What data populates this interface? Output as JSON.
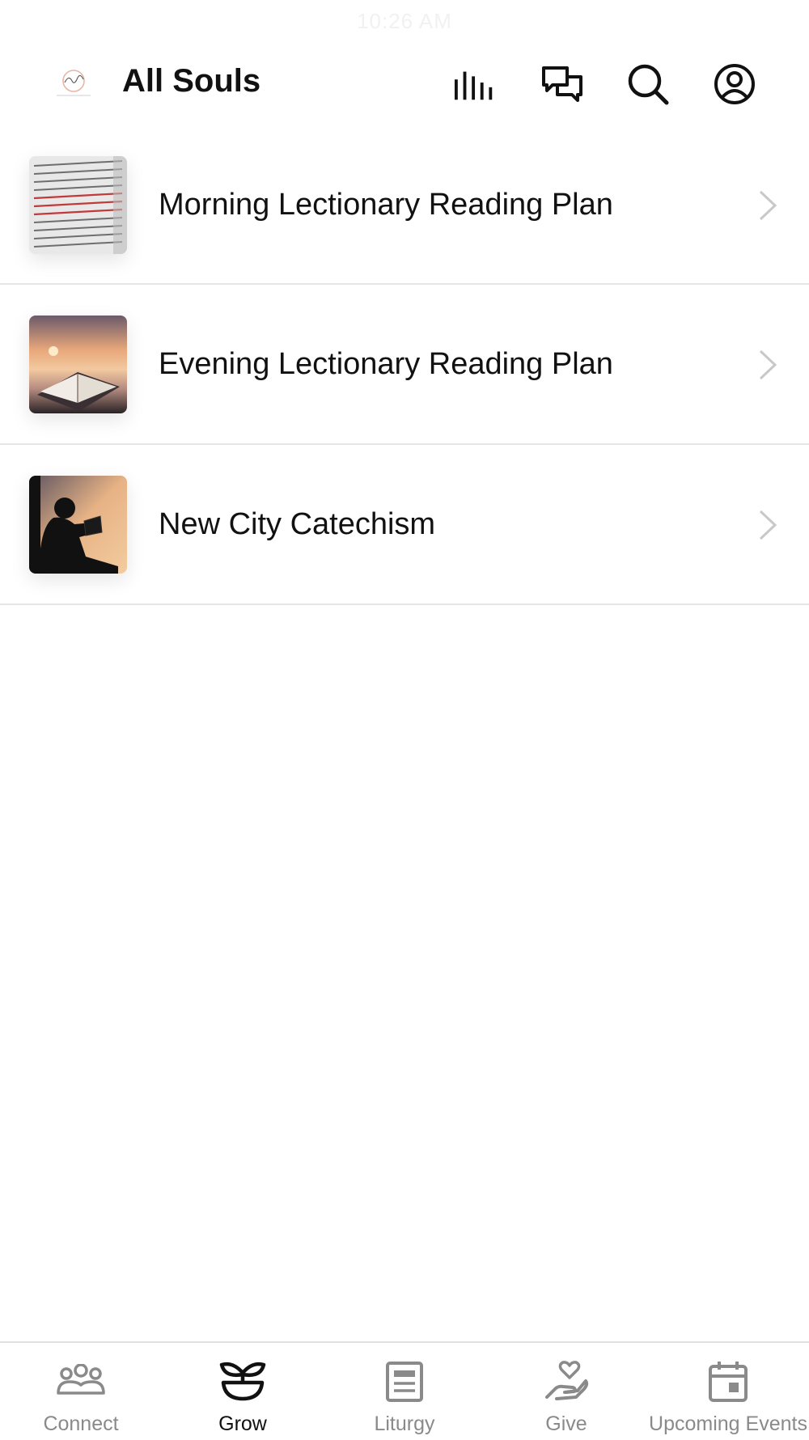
{
  "status_bar": {
    "time": "10:26 AM"
  },
  "header": {
    "title": "All Souls",
    "logo_icon": "all-souls-logo",
    "actions": [
      {
        "icon": "audio-bars-icon"
      },
      {
        "icon": "chat-bubbles-icon"
      },
      {
        "icon": "search-icon"
      },
      {
        "icon": "profile-icon"
      }
    ]
  },
  "list": {
    "items": [
      {
        "label": "Morning Lectionary Reading Plan",
        "image": "bible-page-photo"
      },
      {
        "label": "Evening Lectionary Reading Plan",
        "image": "bible-sunset-photo"
      },
      {
        "label": "New City Catechism",
        "image": "child-reading-silhouette-photo"
      }
    ]
  },
  "tabbar": {
    "tabs": [
      {
        "label": "Connect",
        "icon": "people-icon",
        "active": false
      },
      {
        "label": "Grow",
        "icon": "sprout-icon",
        "active": true
      },
      {
        "label": "Liturgy",
        "icon": "document-icon",
        "active": false
      },
      {
        "label": "Give",
        "icon": "hand-heart-icon",
        "active": false
      },
      {
        "label": "Upcoming Events",
        "icon": "calendar-icon",
        "active": false
      }
    ]
  },
  "colors": {
    "active_tab": "#111111",
    "inactive_tab": "#8a8a8a",
    "divider": "#e6e6e6",
    "chevron": "#c8c8c8"
  }
}
